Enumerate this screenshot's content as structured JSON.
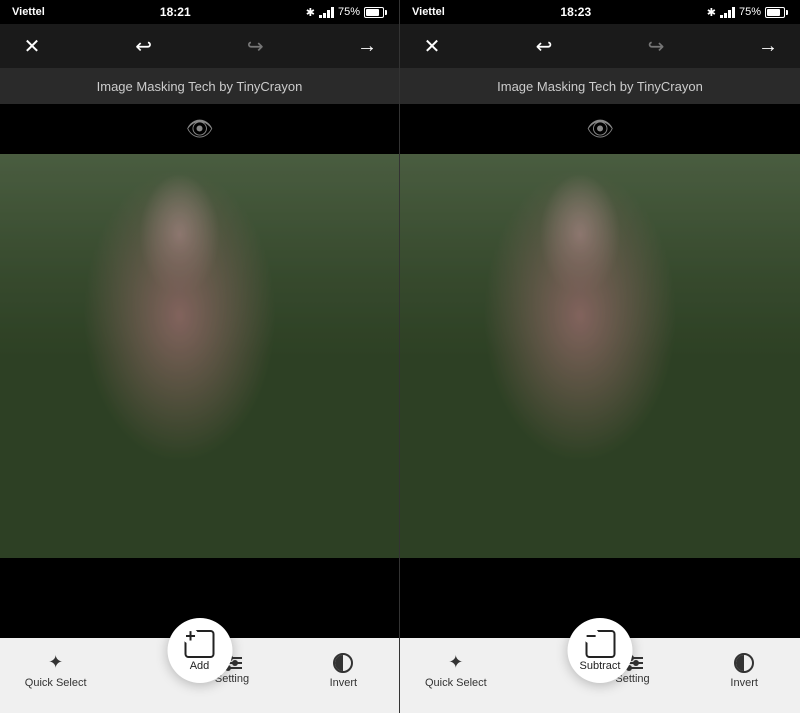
{
  "panels": [
    {
      "id": "left",
      "statusBar": {
        "carrier": "Viettel",
        "time": "18:21",
        "bluetooth": "⊕",
        "battery": "75%"
      },
      "toolbar": {
        "closeLabel": "✕",
        "undoLabel": "↩",
        "redoLabel": "↪",
        "forwardLabel": "→"
      },
      "appTitle": "Image Masking Tech by TinyCrayon",
      "bottomToolbar": {
        "fabLabel": "Add",
        "items": [
          {
            "id": "quick-select",
            "label": "Quick Select"
          },
          {
            "id": "setting",
            "label": "Setting"
          },
          {
            "id": "invert",
            "label": "Invert"
          }
        ]
      }
    },
    {
      "id": "right",
      "statusBar": {
        "carrier": "Viettel",
        "time": "18:23",
        "bluetooth": "⊕",
        "battery": "75%"
      },
      "toolbar": {
        "closeLabel": "✕",
        "undoLabel": "↩",
        "redoLabel": "↪",
        "forwardLabel": "→"
      },
      "appTitle": "Image Masking Tech by TinyCrayon",
      "bottomToolbar": {
        "fabLabel": "Subtract",
        "items": [
          {
            "id": "quick-select",
            "label": "Quick Select"
          },
          {
            "id": "setting",
            "label": "Setting"
          },
          {
            "id": "invert",
            "label": "Invert"
          }
        ]
      }
    }
  ]
}
